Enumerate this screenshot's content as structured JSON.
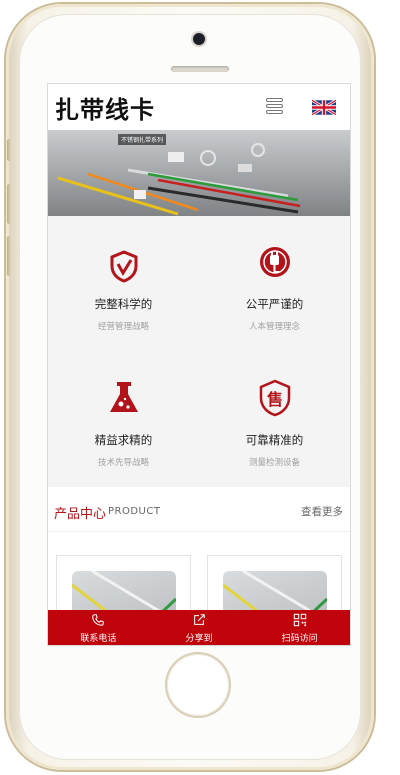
{
  "header": {
    "logo_text": "扎带线卡",
    "menu_icon": "hamburger-menu-icon",
    "language_flag": "uk-flag-icon"
  },
  "banner": {
    "title": "不锈钢扎带系列"
  },
  "features": [
    {
      "icon": "shield-check-icon",
      "title": "完整科学的",
      "subtitle": "经营管理战略"
    },
    {
      "icon": "plug-icon",
      "title": "公平严谨的",
      "subtitle": "人本管理理念"
    },
    {
      "icon": "flask-icon",
      "title": "精益求精的",
      "subtitle": "技术先导战略"
    },
    {
      "icon": "sale-shield-icon",
      "title": "可靠精准的",
      "subtitle": "测量检测设备",
      "icon_text": "售"
    }
  ],
  "products_section": {
    "title": "产品中心",
    "subtitle": "PRODUCT",
    "more_link": "查看更多"
  },
  "bottom_bar": {
    "items": [
      {
        "icon": "phone-icon",
        "label": "联系电话"
      },
      {
        "icon": "share-icon",
        "label": "分享到"
      },
      {
        "icon": "qr-code-icon",
        "label": "扫码访问"
      }
    ]
  },
  "colors": {
    "accent": "#b3141b",
    "bottom_bar": "#c0040b"
  }
}
